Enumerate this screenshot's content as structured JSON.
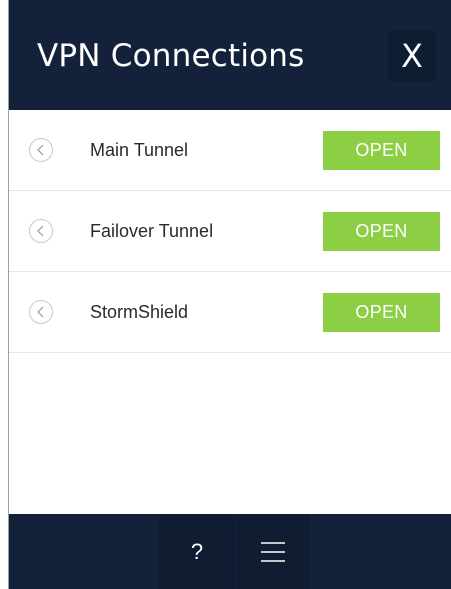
{
  "header": {
    "title": "VPN Connections",
    "close_label": "X"
  },
  "connections": [
    {
      "name": "Main Tunnel",
      "action_label": "OPEN"
    },
    {
      "name": "Failover Tunnel",
      "action_label": "OPEN"
    },
    {
      "name": "StormShield",
      "action_label": "OPEN"
    }
  ],
  "footer": {
    "help_label": "?",
    "menu_icon": "hamburger-menu-icon"
  },
  "colors": {
    "header_bg": "#13223a",
    "open_button": "#8ccf45",
    "row_divider": "#e6e6e6"
  }
}
